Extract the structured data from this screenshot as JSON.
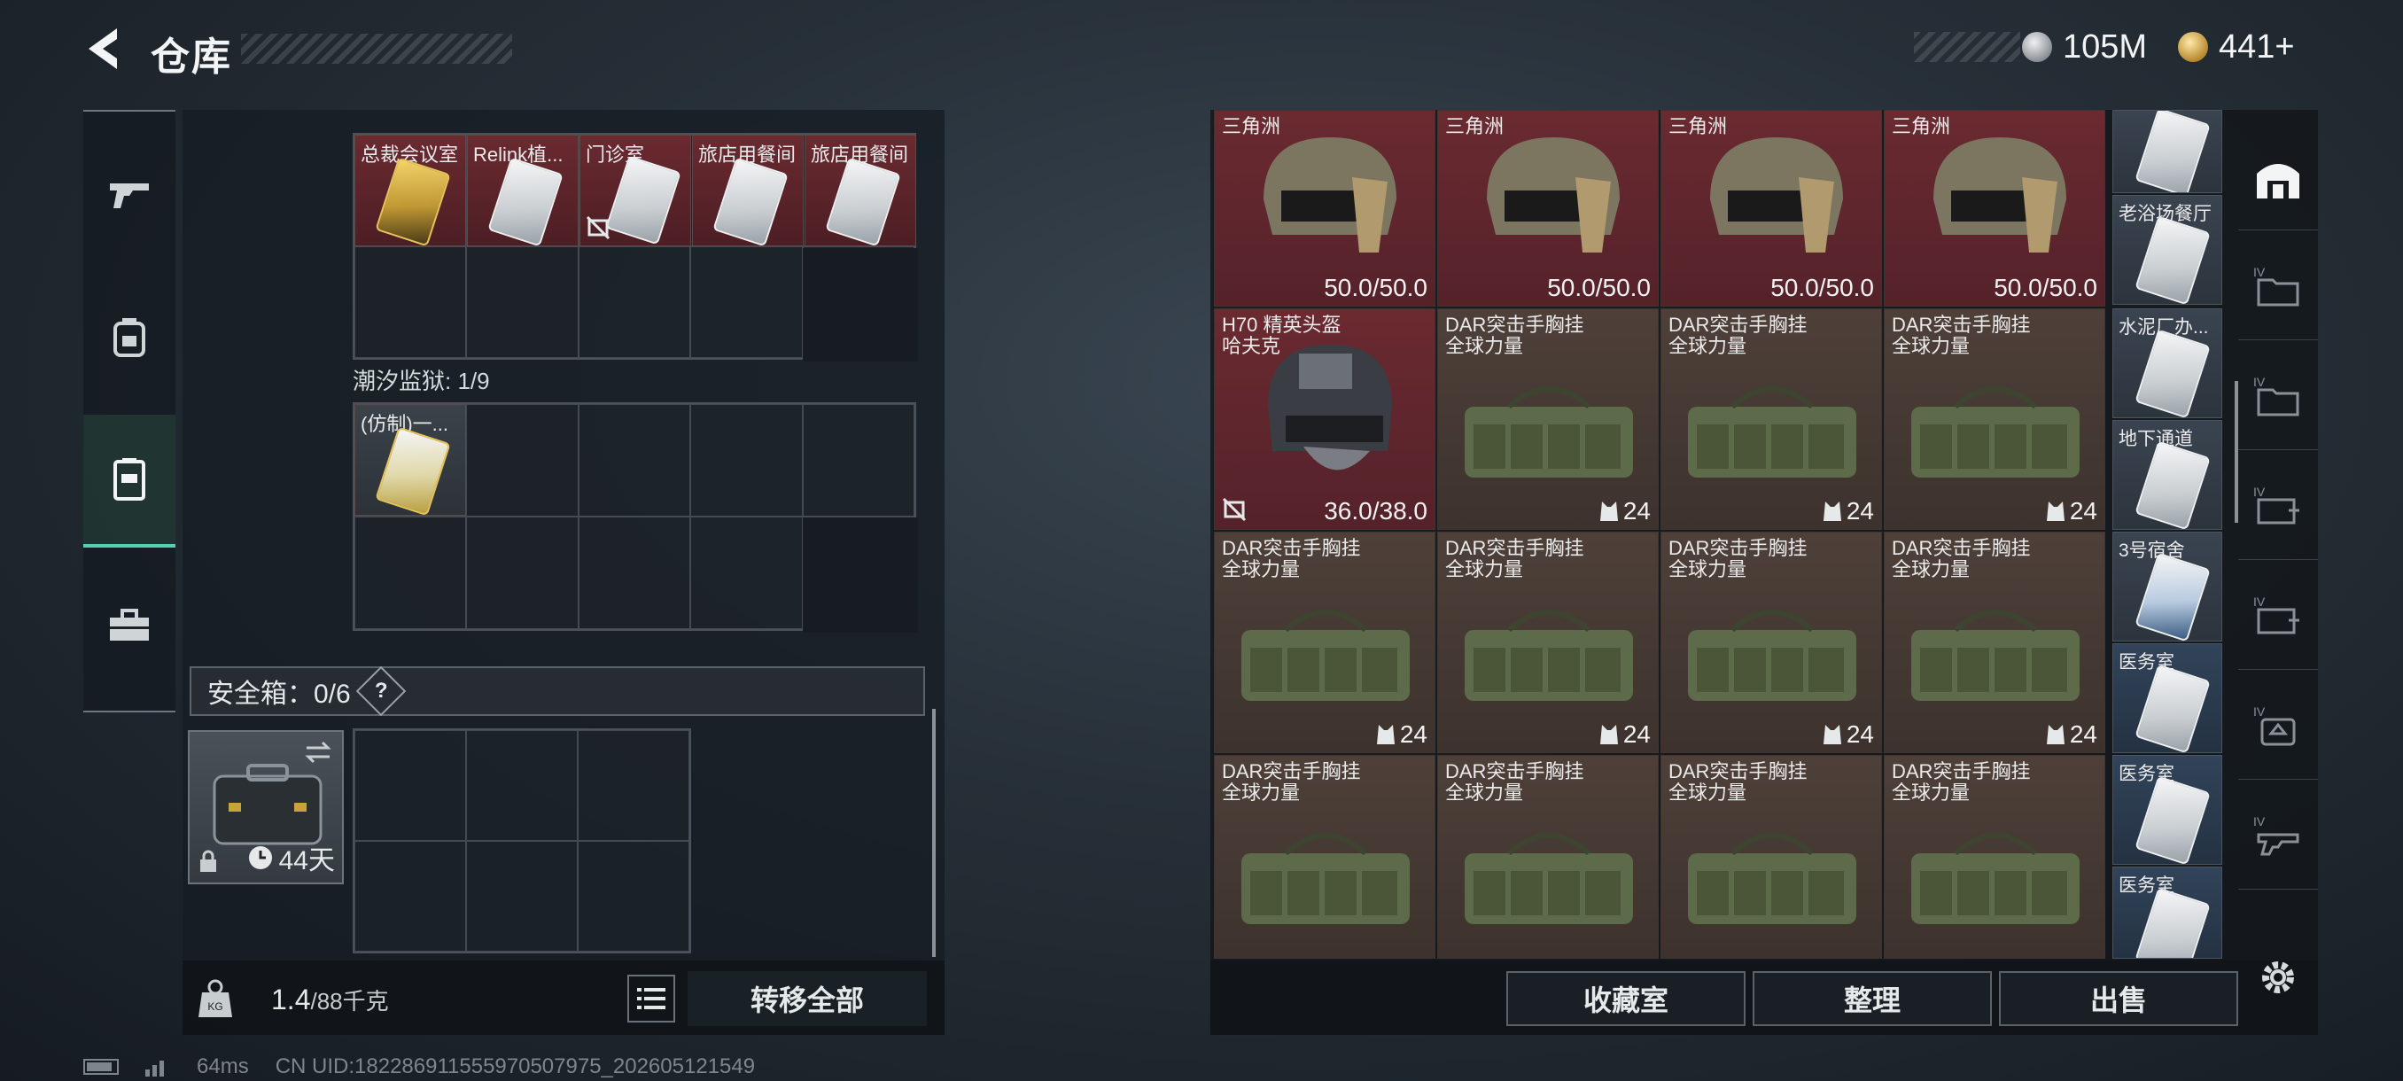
{
  "header": {
    "title": "仓库",
    "currency_silver": "105M",
    "currency_gold": "441+"
  },
  "left_nav": [
    {
      "icon": "gun-icon"
    },
    {
      "icon": "backpack-icon"
    },
    {
      "icon": "vest-icon",
      "active": true
    },
    {
      "icon": "toolbox-icon"
    }
  ],
  "container_top": {
    "cards": [
      {
        "label": "总裁会议室",
        "kind": "gold"
      },
      {
        "label": "Relink植...",
        "kind": "white"
      },
      {
        "label": "门诊室",
        "kind": "white",
        "flag": "no-trade-icon"
      },
      {
        "label": "旅店用餐间",
        "kind": "white"
      },
      {
        "label": "旅店用餐间",
        "kind": "white"
      }
    ]
  },
  "container_prison": {
    "title": "潮汐监狱: 1/9",
    "cards": [
      {
        "label": "(仿制)一...",
        "kind": "white"
      }
    ]
  },
  "safebox": {
    "label": "安全箱：0/6",
    "help": "?",
    "days": "44天"
  },
  "footer_left": {
    "weight": "1.4",
    "weight_max": "/88千克",
    "transfer_all": "转移全部"
  },
  "stash": {
    "row1": [
      {
        "name": "三角洲",
        "value": "50.0/50.0"
      },
      {
        "name": "三角洲",
        "value": "50.0/50.0"
      },
      {
        "name": "三角洲",
        "value": "50.0/50.0"
      },
      {
        "name": "三角洲",
        "value": "50.0/50.0"
      }
    ],
    "row2": [
      {
        "line1": "H70 精英头盔",
        "line2": "哈夫克",
        "value": "36.0/38.0",
        "type": "helmet"
      },
      {
        "line1": "DAR突击手胸挂",
        "line2": "全球力量",
        "value": "24",
        "type": "vest"
      },
      {
        "line1": "DAR突击手胸挂",
        "line2": "全球力量",
        "value": "24",
        "type": "vest"
      },
      {
        "line1": "DAR突击手胸挂",
        "line2": "全球力量",
        "value": "24",
        "type": "vest"
      }
    ],
    "row3": [
      {
        "line1": "DAR突击手胸挂",
        "line2": "全球力量",
        "value": "24"
      },
      {
        "line1": "DAR突击手胸挂",
        "line2": "全球力量",
        "value": "24"
      },
      {
        "line1": "DAR突击手胸挂",
        "line2": "全球力量",
        "value": "24"
      },
      {
        "line1": "DAR突击手胸挂",
        "line2": "全球力量",
        "value": "24"
      }
    ],
    "row4": [
      {
        "line1": "DAR突击手胸挂",
        "line2": "全球力量"
      },
      {
        "line1": "DAR突击手胸挂",
        "line2": "全球力量"
      },
      {
        "line1": "DAR突击手胸挂",
        "line2": "全球力量"
      },
      {
        "line1": "DAR突击手胸挂",
        "line2": "全球力量"
      }
    ],
    "side_keys": [
      {
        "label": ""
      },
      {
        "label": "老浴场餐厅"
      },
      {
        "label": "水泥厂办..."
      },
      {
        "label": "地下通道"
      },
      {
        "label": "3号宿舍"
      },
      {
        "label": "医务室"
      },
      {
        "label": "医务室"
      },
      {
        "label": "医务室"
      }
    ]
  },
  "footer_right": {
    "collection": "收藏室",
    "sort": "整理",
    "sell": "出售"
  },
  "status": {
    "ping": "64ms",
    "uid": "CN UID:1822869115559705079​75_202605121549"
  }
}
